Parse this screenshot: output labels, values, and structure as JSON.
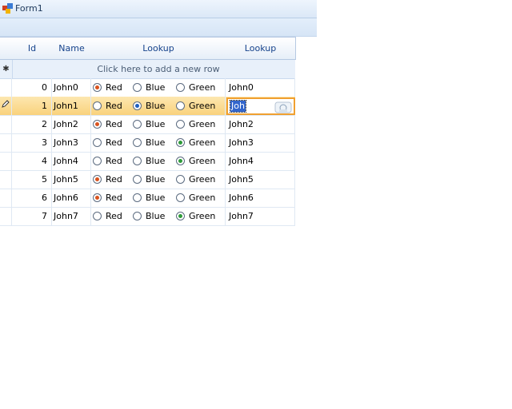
{
  "window": {
    "title": "Form1"
  },
  "grid": {
    "columns": [
      "Id",
      "Name",
      "Lookup",
      "Lookup"
    ],
    "new_row_text": "Click here to add a new row",
    "new_row_indicator": "✱",
    "rows": [
      {
        "id": "0",
        "name": "John0",
        "choice": "Red",
        "text": "John0"
      },
      {
        "id": "1",
        "name": "John1",
        "choice": "Blue",
        "text": "Joh",
        "current": true
      },
      {
        "id": "2",
        "name": "John2",
        "choice": "Red",
        "text": "John2"
      },
      {
        "id": "3",
        "name": "John3",
        "choice": "Green",
        "text": "John3"
      },
      {
        "id": "4",
        "name": "John4",
        "choice": "Green",
        "text": "John4"
      },
      {
        "id": "5",
        "name": "John5",
        "choice": "Red",
        "text": "John5"
      },
      {
        "id": "6",
        "name": "John6",
        "choice": "Red",
        "text": "John6"
      },
      {
        "id": "7",
        "name": "John7",
        "choice": "Green",
        "text": "John7"
      }
    ],
    "radio_options": [
      "Red",
      "Blue",
      "Green"
    ]
  },
  "colors": {
    "red_dot": "#d9531e",
    "blue_dot": "#1f5fbf",
    "green_dot": "#2e9a3a",
    "current_row": "#f9d27c",
    "editor_border": "#f0a030"
  },
  "icons": {
    "app": "form-app-icon",
    "edit_row": "pencil-icon",
    "editor_button": "editor-dropdown-icon"
  }
}
